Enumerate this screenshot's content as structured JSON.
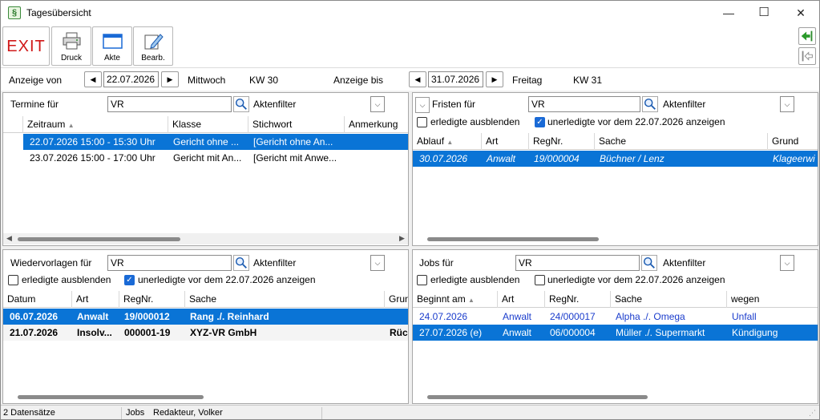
{
  "window": {
    "title": "Tagesübersicht",
    "icon_glyph": "§",
    "min": "—",
    "max": "☐",
    "close": "✕"
  },
  "toolbar": {
    "exit": "EXIT",
    "druck": "Druck",
    "akte": "Akte",
    "bearb": "Bearb."
  },
  "datebar": {
    "label_from": "Anzeige von",
    "date_from": "22.07.2026",
    "day_from": "Mittwoch",
    "kw_from": "KW 30",
    "label_to": "Anzeige bis",
    "date_to": "31.07.2026",
    "day_to": "Freitag",
    "kw_to": "KW 31"
  },
  "termine": {
    "label": "Termine für",
    "search": "VR",
    "filter": "Aktenfilter",
    "columns": [
      "Zeitraum",
      "Klasse",
      "Stichwort",
      "Anmerkung"
    ],
    "rows": [
      [
        "22.07.2026 15:00 - 15:30 Uhr",
        "Gericht ohne ...",
        "[Gericht ohne An...",
        ""
      ],
      [
        "23.07.2026 15:00 - 17:00 Uhr",
        "Gericht mit An...",
        "[Gericht mit Anwe...",
        ""
      ]
    ]
  },
  "fristen": {
    "label": "Fristen für",
    "search": "VR",
    "filter": "Aktenfilter",
    "chk1": "erledigte ausblenden",
    "chk2": "unerledigte vor dem 22.07.2026 anzeigen",
    "columns": [
      "Ablauf",
      "Art",
      "RegNr.",
      "Sache",
      "Grund"
    ],
    "rows": [
      [
        "30.07.2026",
        "Anwalt",
        "19/000004",
        "Büchner / Lenz",
        "Klageerwi"
      ]
    ]
  },
  "wiedervorlagen": {
    "label": "Wiedervorlagen für",
    "search": "VR",
    "filter": "Aktenfilter",
    "chk1": "erledigte ausblenden",
    "chk2": "unerledigte vor dem 22.07.2026 anzeigen",
    "columns": [
      "Datum",
      "Art",
      "RegNr.",
      "Sache",
      "Grun"
    ],
    "rows": [
      [
        "06.07.2026",
        "Anwalt",
        "19/000012",
        "Rang ./. Reinhard",
        ""
      ],
      [
        "21.07.2026",
        "Insolv...",
        "000001-19",
        "XYZ-VR GmbH",
        "Rüc"
      ]
    ]
  },
  "jobs": {
    "label": "Jobs für",
    "search": "VR",
    "filter": "Aktenfilter",
    "chk1": "erledigte ausblenden",
    "chk2": "unerledigte vor dem 22.07.2026 anzeigen",
    "columns": [
      "Beginnt am",
      "Art",
      "RegNr.",
      "Sache",
      "wegen"
    ],
    "rows": [
      [
        "24.07.2026",
        "Anwalt",
        "24/000017",
        "Alpha ./. Omega",
        "Unfall"
      ],
      [
        "27.07.2026 (e)",
        "Anwalt",
        "06/000004",
        "Müller ./. Supermarkt",
        "Kündigung"
      ]
    ]
  },
  "status": {
    "count": "2 Datensätze",
    "section": "Jobs",
    "user": "Redakteur, Volker"
  },
  "colors": {
    "selection": "#0a74d6",
    "link_blue": "#1a3ccc",
    "exit_red": "#d01818"
  }
}
